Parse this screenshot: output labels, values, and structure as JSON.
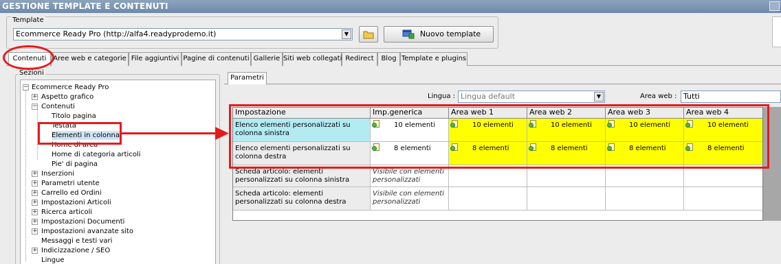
{
  "window": {
    "title": "GESTIONE TEMPLATE E CONTENUTI"
  },
  "template": {
    "label": "Template",
    "selected": "Ecommerce Ready Pro (http://alfa4.readyprodemo.it)",
    "new_button": "Nuovo template"
  },
  "tabs": [
    "Contenuti",
    "Aree web e categorie",
    "File aggiuntivi",
    "Pagine di contenuti",
    "Gallerie",
    "Siti web collegati",
    "Redirect",
    "Blog",
    "Template e plugins"
  ],
  "sections": {
    "label": "Sezioni",
    "tree": [
      "Ecommerce Ready Pro",
      "Aspetto grafico",
      "Contenuti",
      "Titolo pagina",
      "Testata",
      "Elementi in colonna",
      "Home di area",
      "Home di categoria articoli",
      "Pie' di pagina",
      "Inserzioni",
      "Parametri utente",
      "Carrello ed Ordini",
      "Impostazioni Articoli",
      "Ricerca articoli",
      "Impostazioni Documenti",
      "Impostazioni avanzate sito",
      "Messaggi e testi vari",
      "Indicizzazione / SEO",
      "Lingue"
    ]
  },
  "params": {
    "tab": "Parametri",
    "lingua_label": "Lingua :",
    "lingua_value": "Lingua default",
    "area_label": "Area web :",
    "area_value": "Tutti"
  },
  "grid": {
    "headers": [
      "Impostazione",
      "Imp.generica",
      "Area web 1",
      "Area web 2",
      "Area web 3",
      "Area web 4"
    ],
    "rows": [
      {
        "label": "Elenco elementi personalizzati su colonna sinistra",
        "generic": "10 elementi",
        "areas": [
          "10 elementi",
          "10 elementi",
          "10 elementi",
          "10 elementi"
        ]
      },
      {
        "label": "Elenco elementi personalizzati su colonna destra",
        "generic": "8 elementi",
        "areas": [
          "8 elementi",
          "8 elementi",
          "8 elementi",
          "8 elementi"
        ]
      },
      {
        "label": "Scheda articolo: elementi personalizzati su colonna sinistra",
        "generic": "Visibile con elementi personalizzati"
      },
      {
        "label": "Scheda articolo: elementi personalizzati su colonna destra",
        "generic": "Visibile con elementi personalizzati"
      }
    ]
  },
  "colors": {
    "annotation": "#e51b1b",
    "highlight_yellow": "#ffff00",
    "selected_cyan": "#b3ebf3"
  }
}
